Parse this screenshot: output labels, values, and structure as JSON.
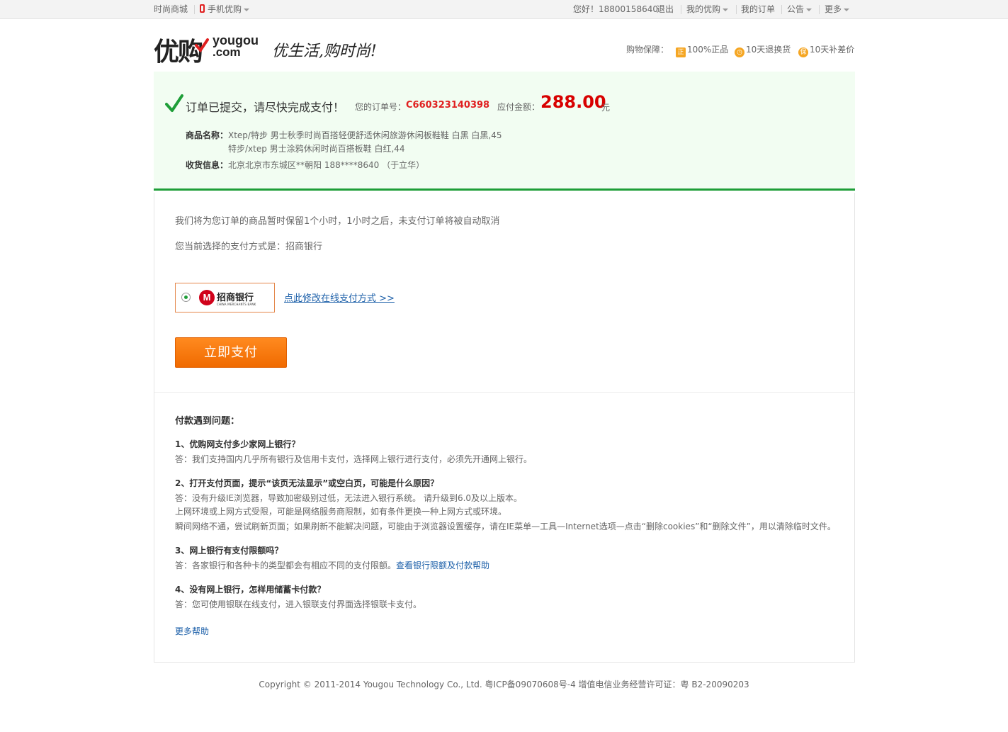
{
  "topbar": {
    "shop": "时尚商城",
    "mobile": "手机优购",
    "greeting": "您好！18800158640",
    "logout": "退出",
    "my_yougou": "我的优购",
    "my_orders": "我的订单",
    "notice": "公告",
    "more": "更多"
  },
  "header": {
    "logo_cn": "优购",
    "logo_en_line1": "yougou",
    "logo_en_line2": ".com",
    "slogan": "优生活,购时尚!",
    "guarantee_label": "购物保障：",
    "guarantees": [
      {
        "icon": "正",
        "text": "100%正品"
      },
      {
        "icon": "clock",
        "text": "10天退换货"
      },
      {
        "icon": "保",
        "text": "10天补差价"
      }
    ]
  },
  "order": {
    "title": "订单已提交，请尽快完成支付！",
    "order_no_label": "您的订单号：",
    "order_no": "C660323140398",
    "amount_label": "应付金额：",
    "amount": "288.00",
    "currency": "元",
    "product_label": "商品名称：",
    "products": [
      "Xtep/特步 男士秋季时尚百搭轻便舒适休闲旅游休闲板鞋鞋 白黑 白黑,45",
      "特步/xtep 男士涂鸦休闲时尚百搭板鞋 白红,44"
    ],
    "shipping_label": "收货信息：",
    "shipping": "北京北京市东城区**朝阳 188****8640 （于立华）"
  },
  "payment": {
    "hold_tip": "我们将为您订单的商品暂时保留1个小时，1小时之后，未支付订单将被自动取消",
    "method_tip": "您当前选择的支付方式是：招商银行",
    "bank_name": "招商银行",
    "bank_en": "CHINA MERCHANTS BANK",
    "change_link": "点此修改在线支付方式 >>",
    "pay_button": "立即支付"
  },
  "faq": {
    "title": "付款遇到问题：",
    "items": [
      {
        "q": "1、优购网支付多少家网上银行？",
        "a": [
          "答：我们支持国内几乎所有银行及信用卡支付，选择网上银行进行支付，必须先开通网上银行。"
        ]
      },
      {
        "q": "2、打开支付页面，提示“该页无法显示”或空白页，可能是什么原因？",
        "a": [
          "答：没有升级IE浏览器，导致加密级别过低，无法进入银行系统。 请升级到6.0及以上版本。",
          "上网环境或上网方式受限，可能是网络服务商限制，如有条件更换一种上网方式或环境。",
          "瞬间网络不通，尝试刷新页面；如果刷新不能解决问题，可能由于浏览器设置缓存，请在IE菜单—工具—Internet选项—点击“删除cookies”和“删除文件”，用以清除临时文件。"
        ]
      },
      {
        "q": "3、网上银行有支付限额吗？",
        "a": [
          "答：各家银行和各种卡的类型都会有相应不同的支付限额。"
        ],
        "link": "查看银行限额及付款帮助"
      },
      {
        "q": "4、没有网上银行，怎样用储蓄卡付款？",
        "a": [
          "答：您可使用银联在线支付，进入银联支付界面选择银联卡支付。"
        ]
      }
    ],
    "more_help": "更多帮助"
  },
  "footer": {
    "copyright": "Copyright © 2011-2014 Yougou Technology Co., Ltd. 粤ICP备09070608号-4 增值电信业务经营许可证：粤 B2-20090203"
  }
}
